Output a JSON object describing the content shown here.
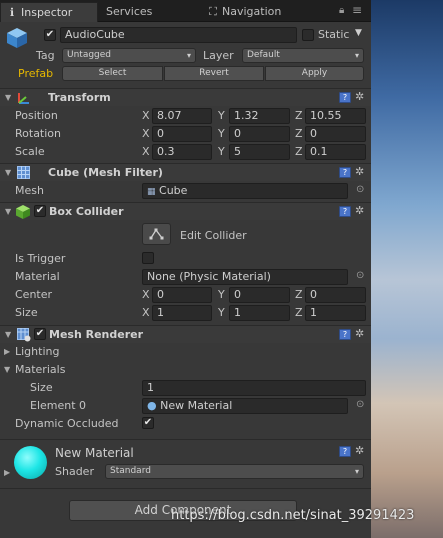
{
  "tabs": [
    {
      "label": "Inspector",
      "icon": "info-icon"
    },
    {
      "label": "Services",
      "icon": ""
    },
    {
      "label": "Navigation",
      "icon": "navigation-icon"
    }
  ],
  "object": {
    "name": "AudioCube",
    "active": true,
    "static_label": "Static",
    "static": false,
    "tag_label": "Tag",
    "tag_value": "Untagged",
    "layer_label": "Layer",
    "layer_value": "Default",
    "prefab_label": "Prefab",
    "prefab_buttons": [
      "Select",
      "Revert",
      "Apply"
    ]
  },
  "transform": {
    "title": "Transform",
    "rows": [
      {
        "label": "Position",
        "x": "8.07",
        "y": "1.32",
        "z": "10.55"
      },
      {
        "label": "Rotation",
        "x": "0",
        "y": "0",
        "z": "0"
      },
      {
        "label": "Scale",
        "x": "0.3",
        "y": "5",
        "z": "0.1"
      }
    ],
    "axes": [
      "X",
      "Y",
      "Z"
    ]
  },
  "mesh_filter": {
    "title": "Cube (Mesh Filter)",
    "mesh_label": "Mesh",
    "mesh_value": "Cube"
  },
  "box_collider": {
    "title": "Box Collider",
    "enabled": true,
    "edit_label": "Edit Collider",
    "is_trigger_label": "Is Trigger",
    "is_trigger": false,
    "material_label": "Material",
    "material_value": "None (Physic Material)",
    "center_label": "Center",
    "center": {
      "x": "0",
      "y": "0",
      "z": "0"
    },
    "size_label": "Size",
    "size": {
      "x": "1",
      "y": "1",
      "z": "1"
    }
  },
  "mesh_renderer": {
    "title": "Mesh Renderer",
    "enabled": true,
    "lighting_label": "Lighting",
    "materials_label": "Materials",
    "size_label": "Size",
    "size_value": "1",
    "element0_label": "Element 0",
    "element0_value": "New Material",
    "dynamic_occluded_label": "Dynamic Occluded",
    "dynamic_occluded": true
  },
  "material": {
    "name": "New Material",
    "shader_label": "Shader",
    "shader_value": "Standard",
    "preview_color": "#1ee6e6"
  },
  "add_component_label": "Add Component",
  "watermark": "https://blog.csdn.net/sinat_39291423"
}
